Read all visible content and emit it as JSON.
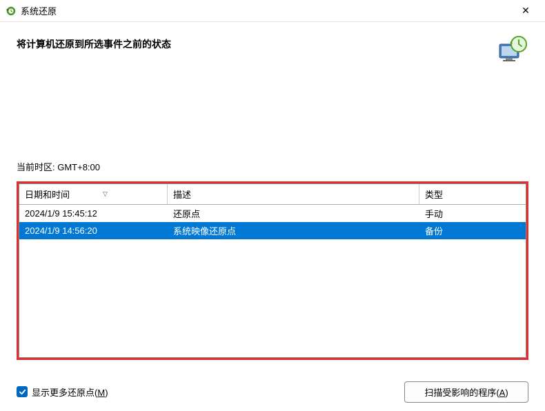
{
  "titlebar": {
    "title": "系统还原"
  },
  "header": {
    "title": "将计算机还原到所选事件之前的状态"
  },
  "content": {
    "timezone_label": "当前时区: GMT+8:00"
  },
  "table": {
    "columns": {
      "date": "日期和时间",
      "desc": "描述",
      "type": "类型"
    },
    "rows": [
      {
        "date": "2024/1/9 15:45:12",
        "desc": "还原点",
        "type": "手动",
        "selected": false
      },
      {
        "date": "2024/1/9 14:56:20",
        "desc": "系统映像还原点",
        "type": "备份",
        "selected": true
      }
    ]
  },
  "footer": {
    "checkbox_label_pre": "显示更多还原点(",
    "checkbox_hotkey": "M",
    "checkbox_label_post": ")",
    "scan_label_pre": "扫描受影响的程序(",
    "scan_hotkey": "A",
    "scan_label_post": ")"
  }
}
